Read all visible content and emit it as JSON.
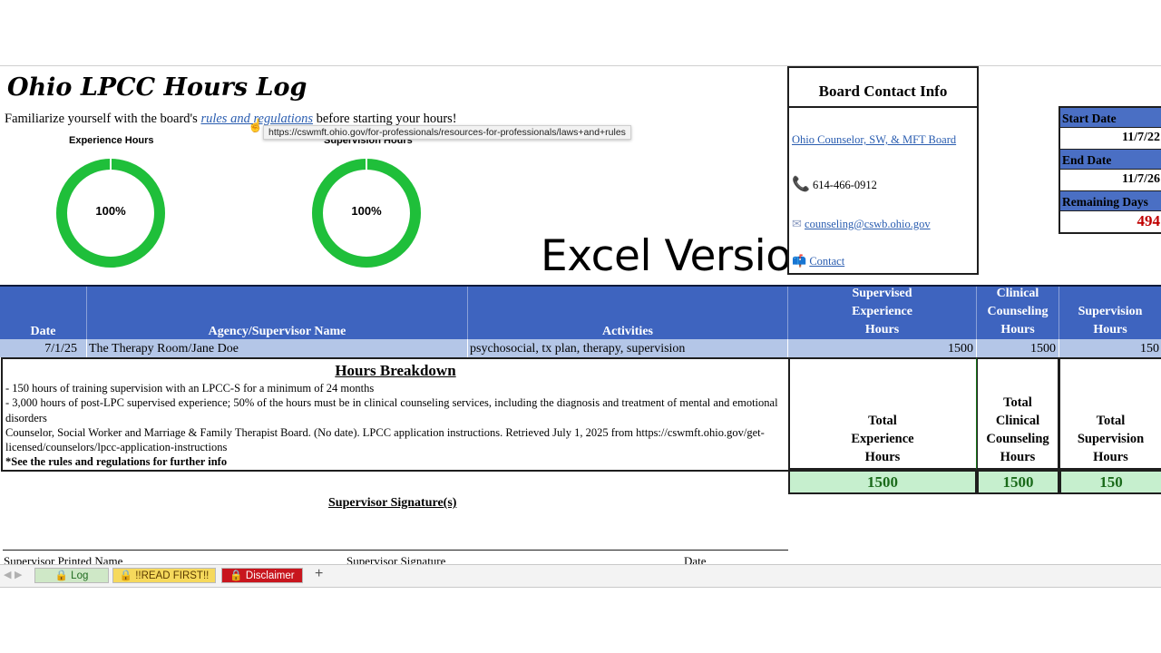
{
  "title": "Ohio LPCC Hours Log",
  "intro": {
    "before": "Familiarize yourself with the board's ",
    "link_text": "rules and regulations",
    "after": " before starting your hours!"
  },
  "tooltip": "https://cswmft.ohio.gov/for-professionals/resources-for-professionals/laws+and+rules",
  "gauges": [
    {
      "label": "Experience Hours",
      "percent_text": "100%",
      "fraction": 1.0
    },
    {
      "label": "Supervision Hours",
      "percent_text": "100%",
      "fraction": 1.0
    }
  ],
  "excel_version": "Excel Version",
  "contact": {
    "heading": "Board Contact Info",
    "board_link": "Ohio Counselor, SW, & MFT Board",
    "phone": "614-466-0912",
    "email": "counseling@cswb.ohio.gov",
    "contact_link": "Contact"
  },
  "dates": {
    "start_label": "Start Date",
    "start_value": "11/7/22",
    "end_label": "End Date",
    "end_value": "11/7/26",
    "remaining_label": "Remaining Days",
    "remaining_value": "494"
  },
  "table": {
    "headers": {
      "date": "Date",
      "agency": "Agency/Supervisor Name",
      "activities": "Activities",
      "supervised": [
        "Supervised",
        "Experience",
        "Hours"
      ],
      "clinical": [
        "Clinical",
        "Counseling",
        "Hours"
      ],
      "supervision": [
        "Supervision",
        "Hours"
      ]
    },
    "rows": [
      {
        "date": "7/1/25",
        "agency": "The Therapy Room/Jane Doe",
        "activities": "psychosocial, tx plan, therapy, supervision",
        "supervised": "1500",
        "clinical": "1500",
        "supervision": "150"
      }
    ]
  },
  "breakdown": {
    "title": "Hours Breakdown",
    "line1": "- 150 hours of training supervision with an LPCC-S for a minimum of 24 months",
    "line2": "- 3,000 hours of post-LPC supervised experience; 50% of the hours must be in clinical counseling services, including the diagnosis and treatment of mental and emotional disorders",
    "line3": "Counselor, Social Worker and Marriage & Family Therapist Board. (No date). LPCC application instructions. Retrieved July 1, 2025 from https://cswmft.ohio.gov/get-licensed/counselors/lpcc-application-instructions",
    "line4": "*See the rules and regulations for further info"
  },
  "totals": {
    "experience_label": [
      "Total",
      "Experience",
      "Hours"
    ],
    "clinical_label": [
      "Total",
      "Clinical",
      "Counseling",
      "Hours"
    ],
    "supervision_label": [
      "Total",
      "Supervision",
      "Hours"
    ],
    "experience_value": "1500",
    "clinical_value": "1500",
    "supervision_value": "150"
  },
  "signature": {
    "title": "Supervisor Signature(s)",
    "printed_name": "Supervisor Printed Name",
    "signature": "Supervisor Signature",
    "date": "Date"
  },
  "tabs": {
    "log": "Log",
    "read_first": "!!READ FIRST!!",
    "disclaimer": "Disclaimer",
    "add": "+"
  },
  "colors": {
    "header_blue": "#3e64bf",
    "row_blue": "#b4c6e7",
    "gauge_green": "#1fbf3a",
    "total_green": "#c6efce",
    "remaining_red": "#c00000"
  }
}
